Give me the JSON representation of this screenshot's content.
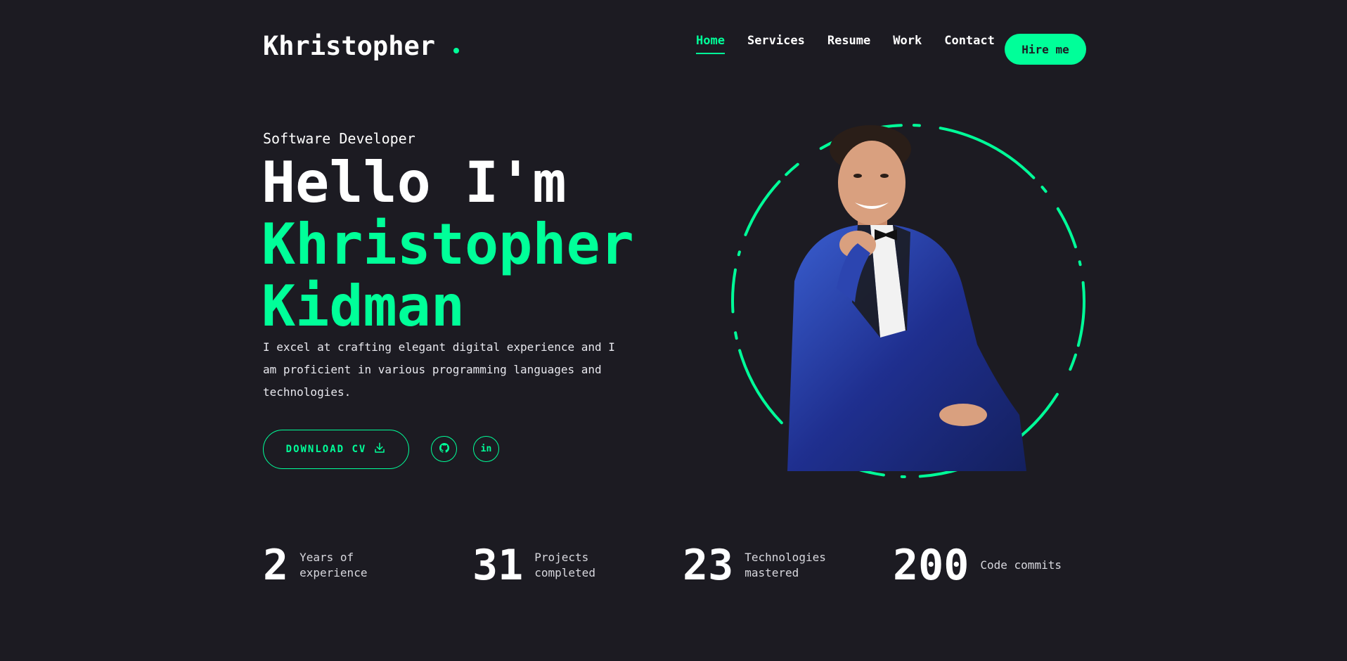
{
  "header": {
    "logo": "Khristopher",
    "nav": [
      "Home",
      "Services",
      "Resume",
      "Work",
      "Contact"
    ],
    "active_nav": "Home",
    "hire_label": "Hire me"
  },
  "hero": {
    "eyebrow": "Software Developer",
    "greeting": "Hello I'm",
    "first_name": "Khristopher",
    "last_name": "Kidman",
    "description": "I excel at crafting elegant digital experience and I am proficient in various programming languages and technologies.",
    "cv_label": "DOWNLOAD CV",
    "social": {
      "github_label": "",
      "linkedin_label": "in"
    }
  },
  "stats": [
    {
      "value": "2",
      "label": "Years of experience"
    },
    {
      "value": "31",
      "label": "Projects completed"
    },
    {
      "value": "23",
      "label": "Technologies mastered"
    },
    {
      "value": "200",
      "label": "Code commits"
    }
  ],
  "colors": {
    "accent": "#00ff99",
    "background": "#1c1b22",
    "text": "#ffffff"
  },
  "icons": {
    "cv": "download-icon",
    "github": "github-icon",
    "linkedin": "linkedin-icon"
  }
}
